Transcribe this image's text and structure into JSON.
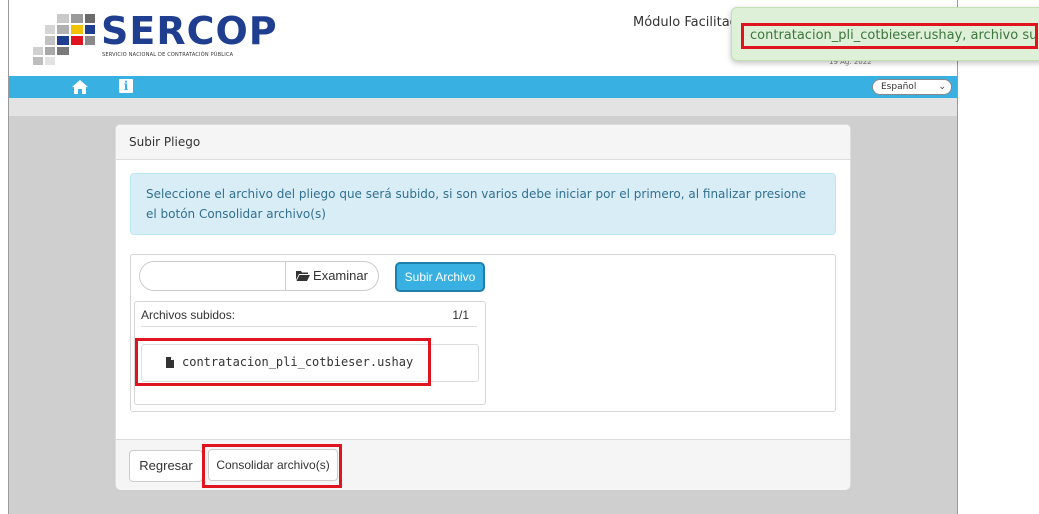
{
  "header": {
    "logo_text": "SERCOP",
    "logo_subtitle": "SERVICIO NACIONAL DE CONTRATACIÓN PÚBLICA",
    "module_title": "Módulo Facilitador de",
    "date_partial": "19 Ag. 2022"
  },
  "toast": {
    "message": "contratacion_pli_cotbieser.ushay, archivo subido."
  },
  "navbar": {
    "home_icon": "home-icon",
    "info_icon": "info-icon",
    "info_glyph": "i",
    "language": "Español"
  },
  "panel": {
    "title": "Subir Pliego",
    "alert": "Seleccione el archivo del pliego que será subido, si son varios debe iniciar por el primero, al finalizar presione el botón Consolidar archivo(s)",
    "file_input_value": "",
    "browse_label": "Examinar",
    "upload_label": "Subir Archivo",
    "files": {
      "header": "Archivos subidos:",
      "count": "1/1",
      "items": [
        {
          "name": "contratacion_pli_cotbieser.ushay",
          "icon": "file-icon"
        }
      ]
    },
    "footer": {
      "back_label": "Regresar",
      "consolidate_label": "Consolidar archivo(s)"
    }
  },
  "colors": {
    "brand_blue": "#1f3e8f",
    "nav_blue": "#39b0e2",
    "highlight_red": "#e0141e",
    "toast_green": "#dff0d8",
    "alert_blue": "#d9edf7"
  }
}
